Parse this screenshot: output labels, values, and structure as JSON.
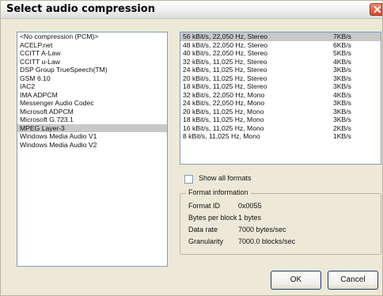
{
  "window": {
    "title": "Select audio compression",
    "close_icon": "close-icon"
  },
  "codecs": {
    "items": [
      "<No compression (PCM)>",
      "ACELP.net",
      "CCITT A-Law",
      "CCITT u-Law",
      "DSP Group TrueSpeech(TM)",
      "GSM 6.10",
      "IAC2",
      "IMA ADPCM",
      "Messenger Audio Codec",
      "Microsoft ADPCM",
      "Microsoft G.723.1",
      "MPEG Layer-3",
      "Windows Media Audio V1",
      "Windows Media Audio V2"
    ],
    "selected_index": 11
  },
  "formats": {
    "items": [
      {
        "format": "56 kBit/s, 22,050 Hz, Stereo",
        "rate": "7KB/s"
      },
      {
        "format": "48 kBit/s, 22,050 Hz, Stereo",
        "rate": "6KB/s"
      },
      {
        "format": "40 kBit/s, 22,050 Hz, Stereo",
        "rate": "5KB/s"
      },
      {
        "format": "32 kBit/s, 11,025 Hz, Stereo",
        "rate": "4KB/s"
      },
      {
        "format": "24 kBit/s, 11,025 Hz, Stereo",
        "rate": "3KB/s"
      },
      {
        "format": "20 kBit/s, 11,025 Hz, Stereo",
        "rate": "3KB/s"
      },
      {
        "format": "18 kBit/s, 11,025 Hz, Stereo",
        "rate": "3KB/s"
      },
      {
        "format": "32 kBit/s, 22,050 Hz, Mono",
        "rate": "4KB/s"
      },
      {
        "format": "24 kBit/s, 22,050 Hz, Mono",
        "rate": "3KB/s"
      },
      {
        "format": "20 kBit/s, 11,025 Hz, Mono",
        "rate": "3KB/s"
      },
      {
        "format": "18 kBit/s, 11,025 Hz, Mono",
        "rate": "3KB/s"
      },
      {
        "format": "16 kBit/s, 11,025 Hz, Mono",
        "rate": "2KB/s"
      },
      {
        "format": "8 kBit/s, 11,025 Hz, Mono",
        "rate": "1KB/s"
      }
    ],
    "selected_index": 0
  },
  "show_all_formats": {
    "label": "Show all formats",
    "checked": false
  },
  "format_info": {
    "legend": "Format information",
    "format_id_label": "Format ID",
    "format_id": "0x0055",
    "bytes_per_block_label": "Bytes per block",
    "bytes_per_block": "1 bytes",
    "data_rate_label": "Data rate",
    "data_rate": "7000 bytes/sec",
    "granularity_label": "Granularity",
    "granularity": "7000.0 blocks/sec"
  },
  "buttons": {
    "ok": "OK",
    "cancel": "Cancel"
  }
}
